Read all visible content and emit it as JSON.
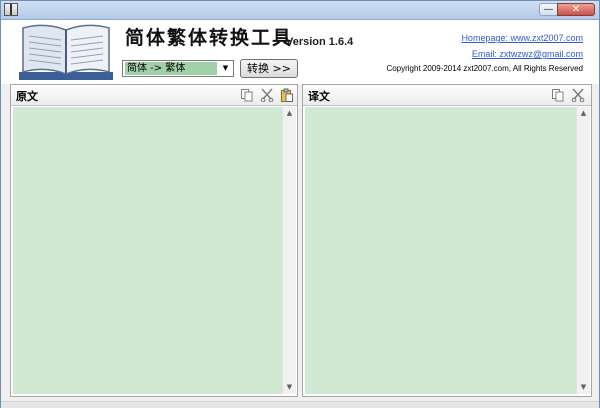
{
  "window": {
    "controls": {
      "minimize": "—",
      "close": "✕"
    }
  },
  "header": {
    "app_title": "简体繁体转换工具",
    "version": "Version 1.6.4",
    "mode_value": "简体 -> 繁体",
    "convert_label": "转换 >>",
    "homepage": "Homepage: www.zxt2007.com",
    "email": "Email: zxtwzwz@gmail.com",
    "copyright": "Copyright 2009-2014 zxt2007.com, All Rights Reserved"
  },
  "source_panel": {
    "title": "原文",
    "tools": [
      "copy-icon",
      "cut-icon",
      "paste-icon"
    ],
    "text": ""
  },
  "target_panel": {
    "title": "译文",
    "tools": [
      "copy-icon",
      "cut-icon"
    ],
    "text": ""
  },
  "scroll": {
    "up": "▲",
    "down": "▼"
  },
  "dropdown_arrow": "▼",
  "colors": {
    "text_area_bg": "#cfe9d2",
    "link": "#2f5bd0",
    "selected_mode_bg": "#9fd0a7"
  }
}
